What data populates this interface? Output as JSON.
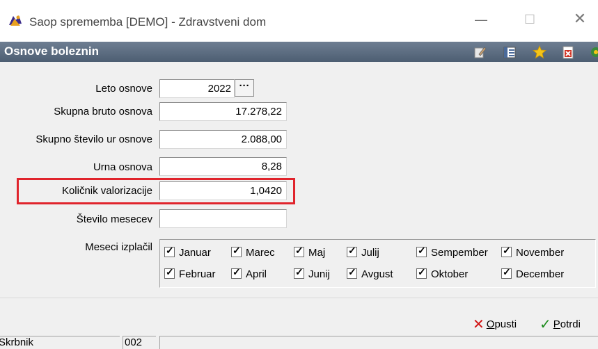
{
  "window": {
    "title": "Saop sprememba [DEMO] - Zdravstveni dom",
    "min_icon": "minimize-icon",
    "max_icon": "maximize-icon",
    "close_icon": "close-icon"
  },
  "section": {
    "title": "Osnove boleznin",
    "toolbar_icons": [
      "edit-icon",
      "columns-icon",
      "star-icon",
      "excel-export-icon",
      "settings-icon"
    ]
  },
  "form": {
    "fields": [
      {
        "label": "Leto osnove",
        "value": "2022",
        "button_label": "···"
      },
      {
        "label": "Skupna bruto osnova",
        "value": "17.278,22"
      },
      {
        "label": "Skupno število ur osnove",
        "value": "2.088,00"
      },
      {
        "label": "Urna osnova",
        "value": "8,28"
      },
      {
        "label": "Količnik valorizacije",
        "value": "1,0420"
      },
      {
        "label": "Število mesecev",
        "value": ""
      }
    ],
    "months_label": "Meseci izplačil",
    "months": [
      {
        "label": "Januar",
        "checked": true
      },
      {
        "label": "Marec",
        "checked": true
      },
      {
        "label": "Maj",
        "checked": true
      },
      {
        "label": "Julij",
        "checked": true
      },
      {
        "label": "Sempember",
        "checked": true
      },
      {
        "label": "November",
        "checked": true
      },
      {
        "label": "Februar",
        "checked": true
      },
      {
        "label": "April",
        "checked": true
      },
      {
        "label": "Junij",
        "checked": true
      },
      {
        "label": "Avgust",
        "checked": true
      },
      {
        "label": "Oktober",
        "checked": true
      },
      {
        "label": "December",
        "checked": true
      }
    ]
  },
  "actions": {
    "cancel": {
      "label_first": "O",
      "label_rest": "pusti",
      "icon": "cancel-x-icon",
      "color": "#d01010"
    },
    "confirm": {
      "label_first": "P",
      "label_rest": "otrdi",
      "icon": "checkmark-icon",
      "color": "#1a8a1a"
    }
  },
  "status": {
    "user": "Skrbnik",
    "code": "002",
    "message": ""
  },
  "colors": {
    "highlight": "#e0242c",
    "section_bar": "#5a6a7e"
  }
}
